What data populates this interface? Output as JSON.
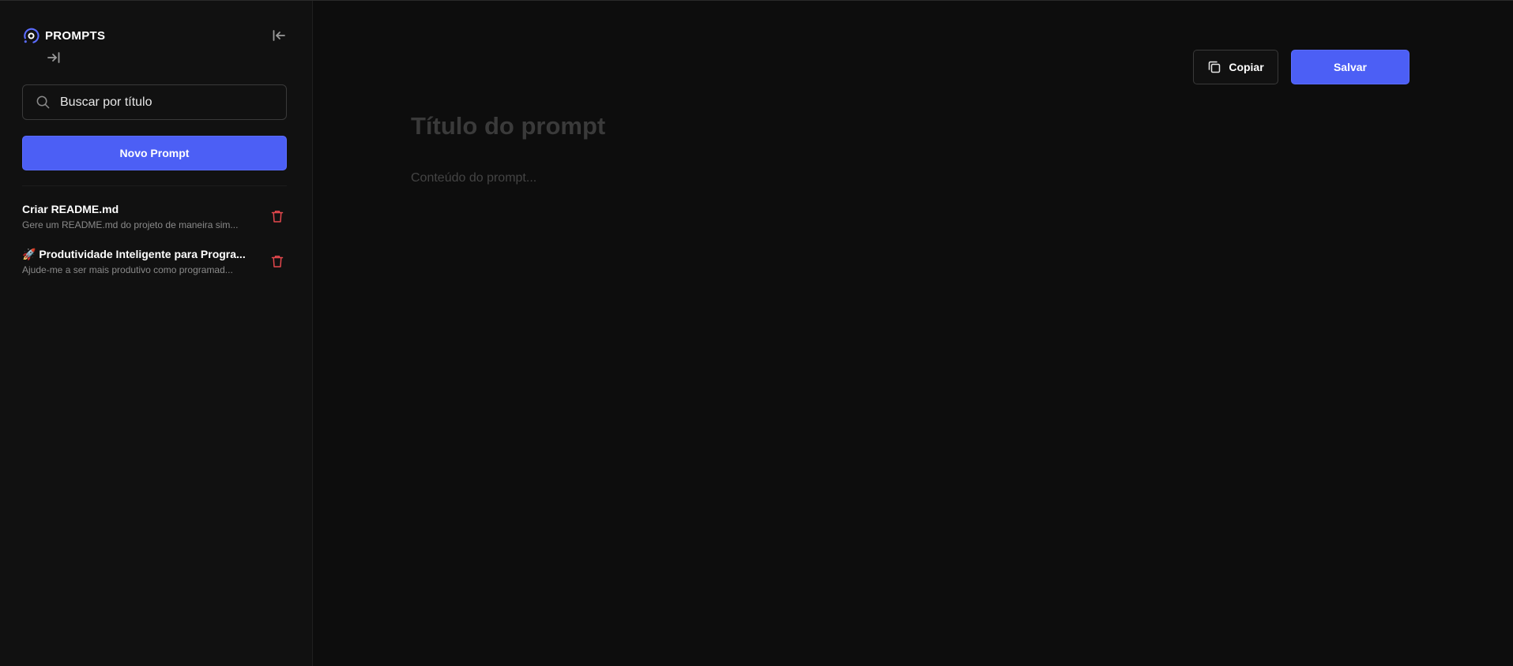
{
  "sidebar": {
    "brand": {
      "name": "PROMPTS",
      "icon": "prompts-logo-icon"
    },
    "collapse_icon": "collapse-left-icon",
    "expand_icon": "expand-right-icon",
    "search": {
      "placeholder": "Buscar por título",
      "value": "",
      "icon": "search-icon"
    },
    "new_prompt_label": "Novo Prompt",
    "prompts": [
      {
        "title": "Criar README.md",
        "description": "Gere um README.md do projeto de maneira sim...",
        "delete_icon": "trash-icon"
      },
      {
        "title": "🚀 Produtividade Inteligente para Progra...",
        "description": "Ajude-me a ser mais produtivo como programad...",
        "delete_icon": "trash-icon"
      }
    ]
  },
  "toolbar": {
    "copy_label": "Copiar",
    "copy_icon": "copy-icon",
    "save_label": "Salvar"
  },
  "editor": {
    "title_placeholder": "Título do prompt",
    "content_placeholder": "Conteúdo do prompt..."
  },
  "colors": {
    "accent": "#4c5ff5",
    "background": "#0d0d0d",
    "sidebar": "#111111",
    "danger": "#e5484d"
  }
}
